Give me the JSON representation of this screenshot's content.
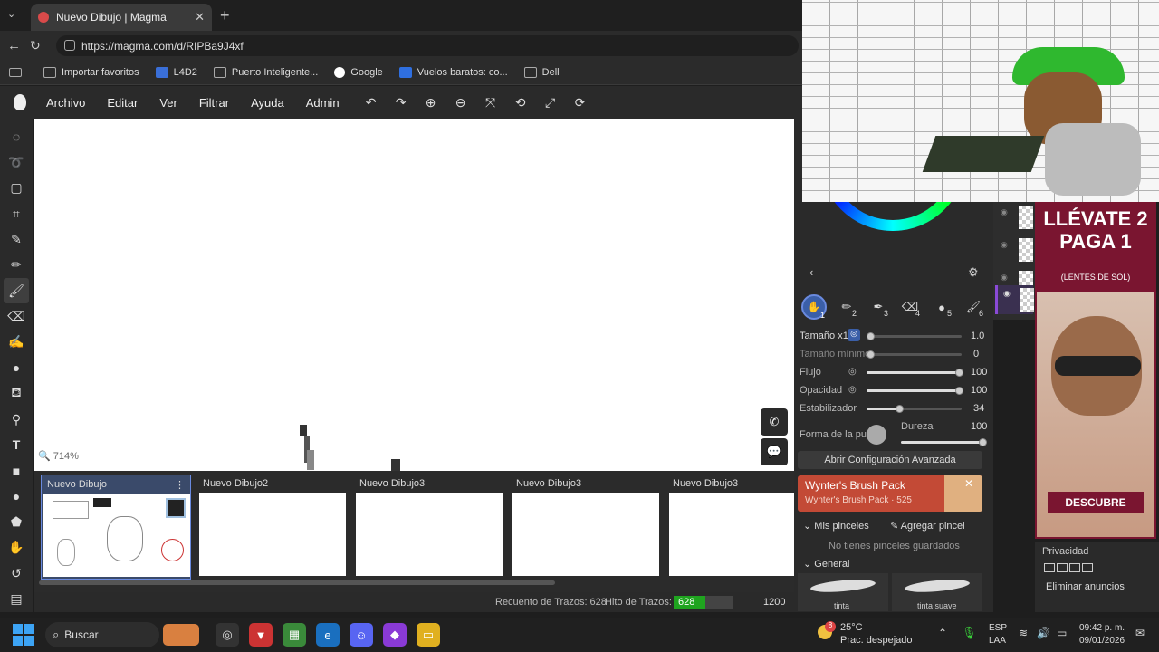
{
  "browser": {
    "tab_title": "Nuevo Dibujo | Magma",
    "url": "https://magma.com/d/RIPBa9J4xf",
    "bookmarks": [
      {
        "label": "Importar favoritos",
        "icon": "import-icon"
      },
      {
        "label": "L4D2",
        "icon": "bookmark-icon"
      },
      {
        "label": "Puerto Inteligente...",
        "icon": "bookmark-icon"
      },
      {
        "label": "Google",
        "icon": "google-icon"
      },
      {
        "label": "Vuelos baratos: co...",
        "icon": "bookmark-icon"
      },
      {
        "label": "Dell",
        "icon": "folder-icon"
      }
    ]
  },
  "menu": {
    "items": [
      "Archivo",
      "Editar",
      "Ver",
      "Filtrar",
      "Ayuda",
      "Admin"
    ],
    "tools": [
      "undo-icon",
      "redo-icon",
      "zoom-in-icon",
      "zoom-out-icon",
      "fit-icon",
      "rotate-icon",
      "fullscreen-icon",
      "reset-rotation-icon"
    ]
  },
  "canvas": {
    "zoom": "714%"
  },
  "documents": [
    {
      "title": "Nuevo Dibujo",
      "active": true
    },
    {
      "title": "Nuevo Dibujo2",
      "active": false
    },
    {
      "title": "Nuevo Dibujo3",
      "active": false
    },
    {
      "title": "Nuevo Dibujo3",
      "active": false
    },
    {
      "title": "Nuevo Dibujo3",
      "active": false
    }
  ],
  "status": {
    "stroke_count_label": "Recuento de Trazos: 628",
    "stroke_milestone_label": "Hito de Trazos:",
    "progress_value": "628",
    "progress_max": "1200",
    "progress_fraction": 0.523
  },
  "brush_panel": {
    "slots": [
      "1",
      "2",
      "3",
      "4",
      "5",
      "6"
    ],
    "size_label": "Tamaño x1",
    "size_value": "1.0",
    "min_size_label": "Tamaño mínimo",
    "min_size_value": "0",
    "flow_label": "Flujo",
    "flow_value": "100",
    "opacity_label": "Opacidad",
    "opacity_value": "100",
    "stabilizer_label": "Estabilizador",
    "stabilizer_value": "34",
    "tip_shape_label": "Forma de la pu",
    "hardness_label": "Dureza",
    "hardness_value": "100",
    "advanced_button": "Abrir Configuración Avanzada",
    "promo_title": "Wynter's Brush Pack",
    "promo_sub": "Wynter's Brush Pack · 525",
    "my_brushes": "Mis pinceles",
    "add_brush": "Agregar pincel",
    "no_brushes": "No tienes pinceles guardados",
    "general": "General",
    "brush_names": [
      "tinta",
      "tinta suave"
    ]
  },
  "ad": {
    "headline1": "LLÉVATE 2",
    "headline2": "PAGA 1",
    "sub": "(LENTES DE SOL)",
    "cta": "DESCUBRE"
  },
  "privacy": {
    "title": "Privacidad",
    "remove_ads": "Eliminar anuncios"
  },
  "taskbar": {
    "search": "Buscar",
    "weather_temp": "25°C",
    "weather_desc": "Prac. despejado",
    "lang1": "ESP",
    "lang2": "LAA",
    "time": "09:42 p. m.",
    "date": "09/01/2026",
    "weather_badge": "8"
  },
  "colors": {
    "accent": "#4a7fd6",
    "progress_green": "#1fa41f",
    "promo_bg": "#c34a36"
  }
}
